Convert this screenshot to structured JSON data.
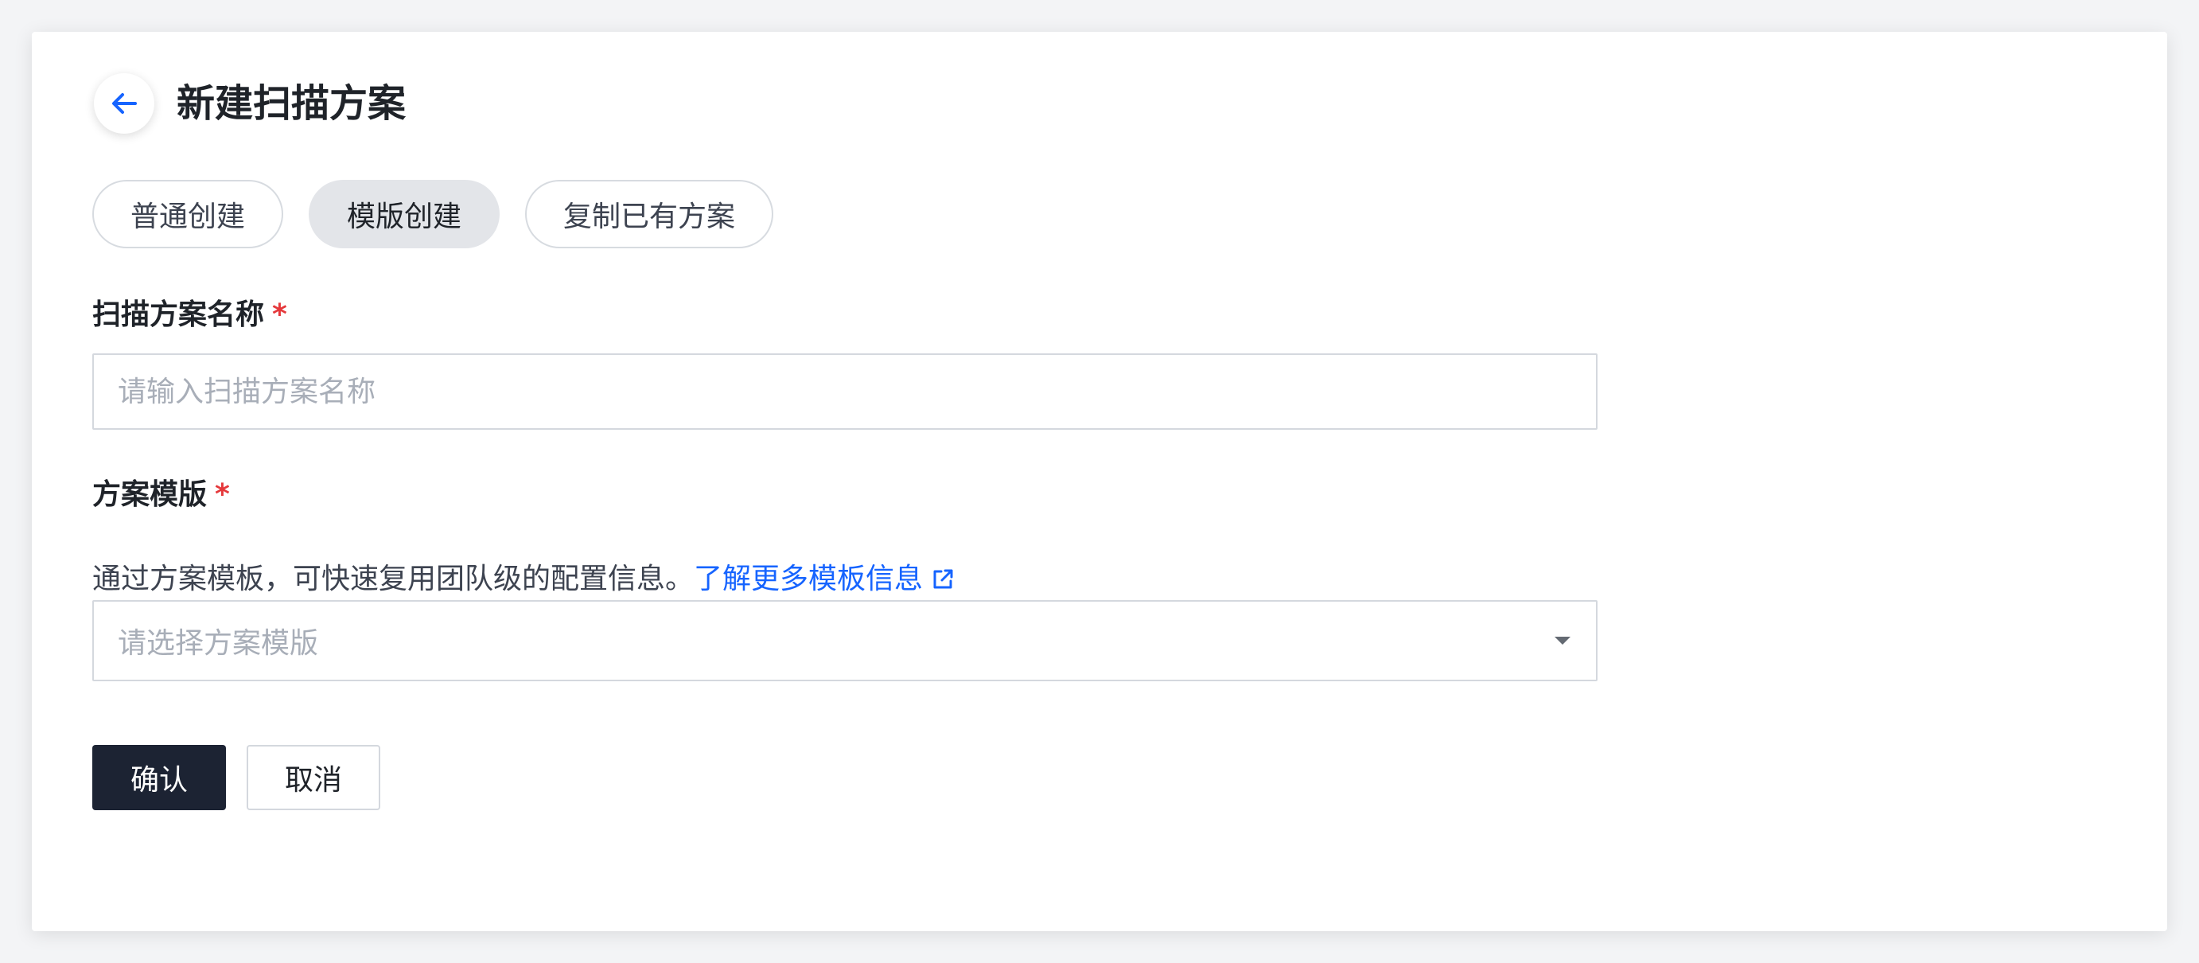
{
  "header": {
    "title": "新建扫描方案"
  },
  "tabs": [
    {
      "label": "普通创建",
      "active": false
    },
    {
      "label": "模版创建",
      "active": true
    },
    {
      "label": "复制已有方案",
      "active": false
    }
  ],
  "form": {
    "name": {
      "label": "扫描方案名称",
      "required_mark": "*",
      "value": "",
      "placeholder": "请输入扫描方案名称"
    },
    "template": {
      "label": "方案模版",
      "required_mark": "*",
      "description": "通过方案模板，可快速复用团队级的配置信息。",
      "link_text": "了解更多模板信息",
      "placeholder": "请选择方案模版"
    }
  },
  "actions": {
    "confirm_label": "确认",
    "cancel_label": "取消"
  },
  "colors": {
    "accent": "#1664ff",
    "primary_button": "#1c2333",
    "required": "#e5383b"
  }
}
